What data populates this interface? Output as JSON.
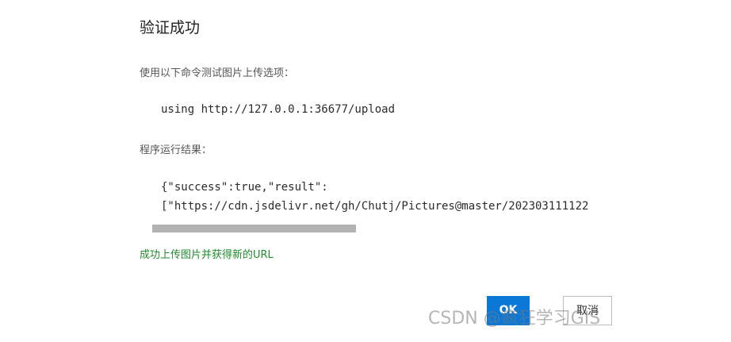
{
  "dialog": {
    "title": "验证成功",
    "command_label": "使用以下命令测试图片上传选项：",
    "command": "using http://127.0.0.1:36677/upload",
    "result_label": "程序运行结果：",
    "result_line1": "{\"success\":true,\"result\":",
    "result_line2": "[\"https://cdn.jsdelivr.net/gh/Chutj/Pictures@master/202303111122",
    "success_message": "成功上传图片并获得新的URL",
    "ok_label": "OK",
    "cancel_label": "取消"
  },
  "watermark": {
    "text": "CSDN @疯狂学习GIS"
  },
  "colors": {
    "accent": "#0a78d7",
    "success": "#1f8b2d",
    "scrollbar": "#b2b2b2"
  }
}
